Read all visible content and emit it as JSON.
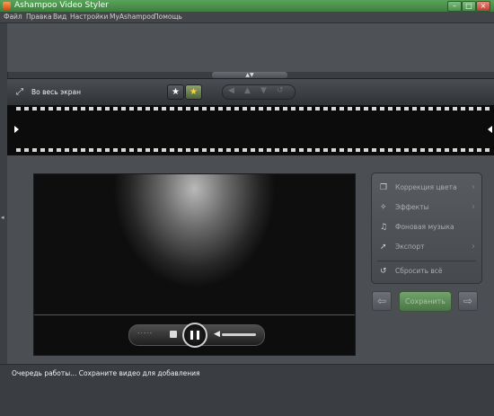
{
  "window": {
    "title": "Ashampoo Video Styler"
  },
  "menu": {
    "items": [
      "Файл",
      "Правка",
      "Вид",
      "Настройки",
      "MyAshampoo",
      "Помощь"
    ]
  },
  "toolbar": {
    "fullscreen_label": "Во весь экран"
  },
  "side_panel": {
    "items": [
      {
        "label": "Коррекция цвета",
        "icon": "color-correction-icon"
      },
      {
        "label": "Эффекты",
        "icon": "magic-wand-icon"
      },
      {
        "label": "Фоновая музыка",
        "icon": "music-note-icon"
      },
      {
        "label": "Экспорт",
        "icon": "export-arrow-icon"
      }
    ],
    "reset_label": "Сбросить всё"
  },
  "actions": {
    "save_label": "Сохранить"
  },
  "status": {
    "queue_text": "Очередь работы... Сохраните видео для добавления"
  },
  "colors": {
    "title_green": "#4f9350",
    "accent_green": "#5f8d59",
    "background": "#4b4e53"
  }
}
